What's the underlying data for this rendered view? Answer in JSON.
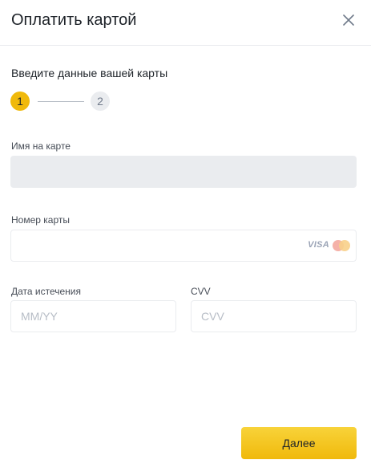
{
  "header": {
    "title": "Оплатить картой",
    "close_icon": "close-icon"
  },
  "form": {
    "subtitle": "Введите данные вашей карты",
    "steps": [
      "1",
      "2"
    ],
    "card_name": {
      "label": "Имя на карте",
      "value": "",
      "placeholder": ""
    },
    "card_number": {
      "label": "Номер карты",
      "value": "",
      "placeholder": "",
      "brands": [
        "VISA",
        "Mastercard"
      ]
    },
    "expiry": {
      "label": "Дата истечения",
      "value": "",
      "placeholder": "MM/YY"
    },
    "cvv": {
      "label": "CVV",
      "value": "",
      "placeholder": "CVV"
    }
  },
  "footer": {
    "next_label": "Далее"
  },
  "colors": {
    "accent": "#f0b90b",
    "step_inactive": "#eaecef",
    "text": "#1e2329",
    "field_disabled": "#eaecef"
  }
}
